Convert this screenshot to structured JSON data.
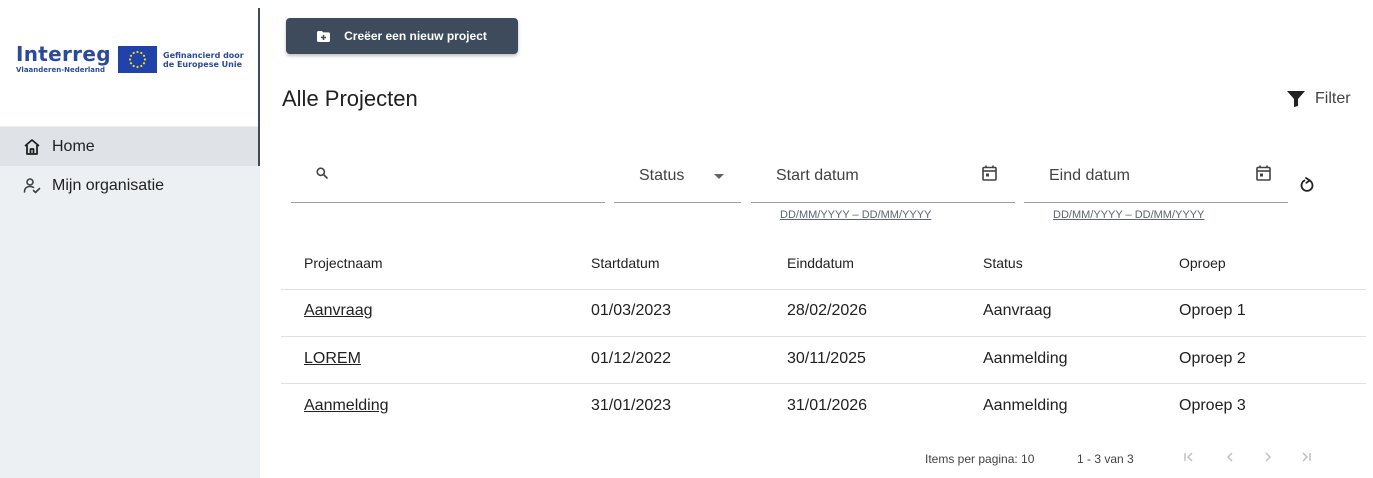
{
  "logo": {
    "brand": "Interreg",
    "region": "Vlaanderen-Nederland",
    "funding_line1": "Gefinancierd door",
    "funding_line2": "de Europese Unie"
  },
  "sidebar": {
    "items": [
      {
        "label": "Home",
        "icon": "home-icon",
        "active": true
      },
      {
        "label": "Mijn organisatie",
        "icon": "person-check-icon",
        "active": false
      }
    ]
  },
  "toolbar": {
    "create_label": "Creëer een nieuw project",
    "filter_label": "Filter"
  },
  "page": {
    "title": "Alle Projecten"
  },
  "filters": {
    "status_label": "Status",
    "start_label": "Start datum",
    "end_label": "Eind datum",
    "start_hint": "DD/MM/YYYY – DD/MM/YYYY",
    "end_hint": "DD/MM/YYYY – DD/MM/YYYY"
  },
  "table": {
    "headers": [
      "Projectnaam",
      "Startdatum",
      "Einddatum",
      "Status",
      "Oproep"
    ],
    "rows": [
      [
        "Aanvraag",
        "01/03/2023",
        "28/02/2026",
        "Aanvraag",
        "Oproep 1"
      ],
      [
        "LOREM",
        "01/12/2022",
        "30/11/2025",
        "Aanmelding",
        "Oproep 2"
      ],
      [
        "Aanmelding",
        "31/01/2023",
        "31/01/2026",
        "Aanmelding",
        "Oproep 3"
      ]
    ]
  },
  "paginator": {
    "items_per_page": "Items per pagina: 10",
    "range": "1 - 3 van 3"
  },
  "colors": {
    "primary": "#3d4b5c",
    "sidebar_bg": "#edf0f3",
    "brand_blue": "#2c4a9a",
    "eu_blue": "#1f43a8",
    "eu_star": "#ffd617"
  }
}
